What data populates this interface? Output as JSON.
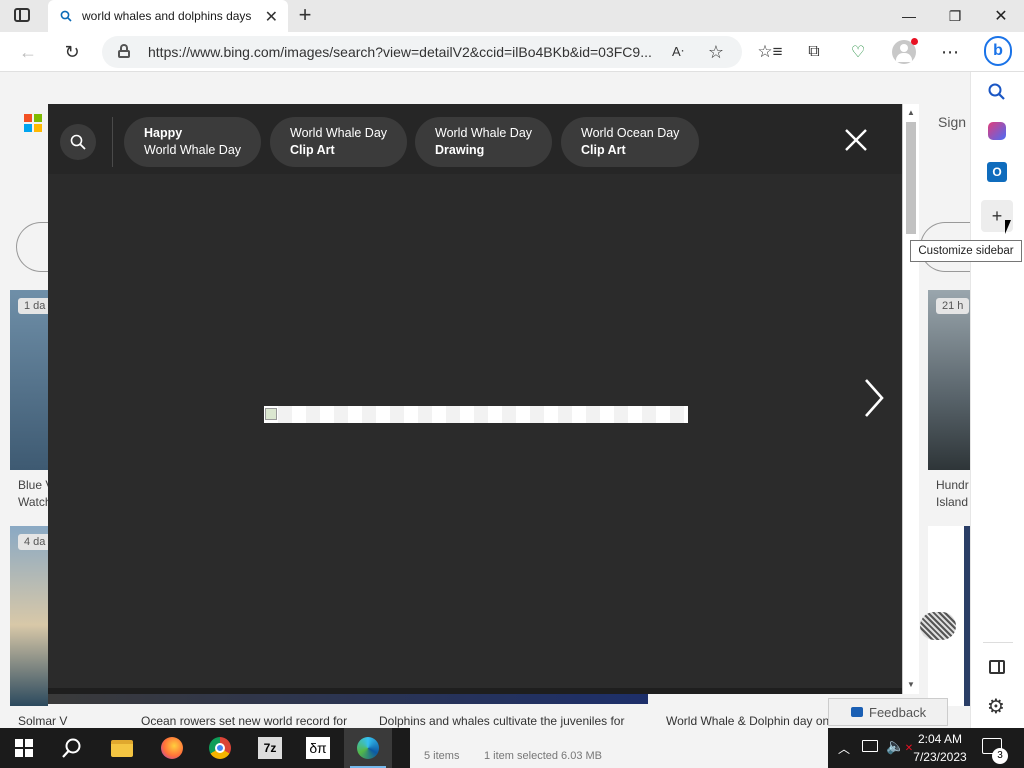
{
  "browser": {
    "tab_title": "world whales and dolphins days",
    "url": "https://www.bing.com/images/search?view=detailV2&ccid=ilBo4BKb&id=03FC9...",
    "tooltip": "Customize sidebar"
  },
  "modal": {
    "chips": [
      {
        "line1": "Happy",
        "line2": "World Whale Day"
      },
      {
        "line1": "World Whale Day",
        "line2": "Clip Art"
      },
      {
        "line1": "World Whale Day",
        "line2": "Drawing"
      },
      {
        "line1": "World Ocean Day",
        "line2": "Clip Art"
      }
    ]
  },
  "background_page": {
    "badges": [
      "1 da",
      "4 da",
      "21 h"
    ],
    "left_captions": [
      "Blue V",
      "Watch"
    ],
    "right_captions": [
      "Hundr",
      "Island"
    ],
    "bottom_captions": [
      "Solmar V",
      "Ocean rowers set new world record for",
      "Dolphins and whales cultivate the juveniles for",
      "World Whale & Dolphin day on"
    ],
    "sign_in": "Sign",
    "feedback": "Feedback",
    "status_left": "5 items",
    "status_mid": "1 item selected  6.03 MB"
  },
  "taskbar": {
    "time": "2:04 AM",
    "date": "7/23/2023",
    "notifications": "3"
  },
  "colors": {
    "accent": "#0078d4",
    "modal_bg": "#2b2b2b",
    "chip_bg": "#3b3b3b"
  }
}
